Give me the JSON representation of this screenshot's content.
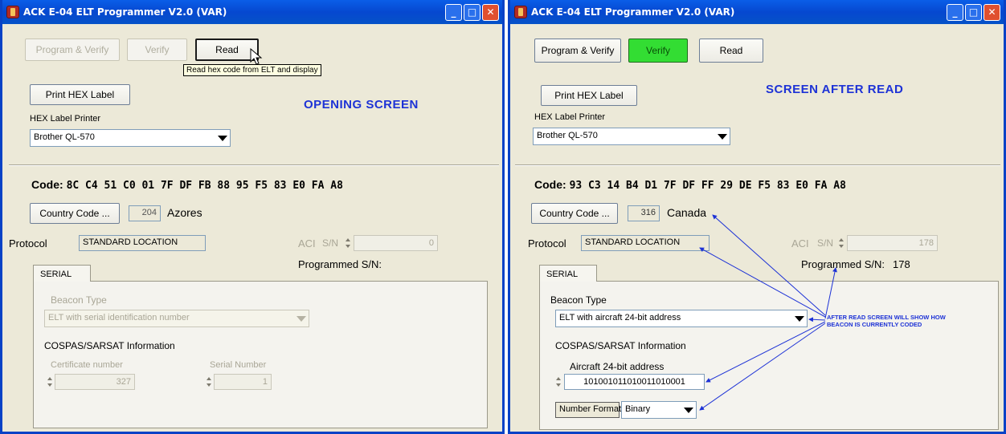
{
  "left": {
    "window_title": "ACK E-04 ELT Programmer V2.0 (VAR)",
    "btn_program_verify": "Program & Verify",
    "btn_verify": "Verify",
    "btn_read": "Read",
    "tooltip": "Read hex code from ELT and display",
    "btn_print_hex": "Print HEX Label",
    "caption": "OPENING SCREEN",
    "printer_label": "HEX Label Printer",
    "printer_value": "Brother QL-570",
    "code_label": "Code:",
    "code_hex": "8C C4 51 C0 01 7F DF FB 88 95 F5 83 E0 FA A8",
    "btn_country_code": "Country Code ...",
    "country_number": "204",
    "country_name": "Azores",
    "protocol_label": "Protocol",
    "protocol_value": "STANDARD LOCATION",
    "acl_label": "ACI",
    "sn_label": "S/N",
    "sn_value": "0",
    "programmed_sn_label": "Programmed S/N:",
    "programmed_sn_value": "",
    "tab_serial": "SERIAL",
    "beacon_type_label": "Beacon Type",
    "beacon_type_value": "ELT with serial identification number",
    "cospas_label": "COSPAS/SARSAT Information",
    "cert_label": "Certificate number",
    "cert_value": "327",
    "serial_label": "Serial Number",
    "serial_value": "1"
  },
  "right": {
    "window_title": "ACK E-04 ELT Programmer V2.0 (VAR)",
    "btn_program_verify": "Program & Verify",
    "btn_verify": "Verify",
    "btn_read": "Read",
    "btn_print_hex": "Print HEX Label",
    "caption": "SCREEN AFTER READ",
    "printer_label": "HEX Label Printer",
    "printer_value": "Brother QL-570",
    "code_label": "Code:",
    "code_hex": "93 C3 14 B4 D1 7F DF FF 29 DE F5 83 E0 FA A8",
    "btn_country_code": "Country Code ...",
    "country_number": "316",
    "country_name": "Canada",
    "protocol_label": "Protocol",
    "protocol_value": "STANDARD LOCATION",
    "acl_label": "ACI",
    "sn_label": "S/N",
    "sn_value": "178",
    "programmed_sn_label": "Programmed S/N:",
    "programmed_sn_value": "178",
    "tab_serial": "SERIAL",
    "beacon_type_label": "Beacon Type",
    "beacon_type_value": "ELT with aircraft 24-bit address",
    "cospas_label": "COSPAS/SARSAT Information",
    "aircraft_addr_label": "Aircraft 24-bit address",
    "aircraft_addr_value": "101001011010011010001",
    "number_format_label": "Number Format",
    "number_format_value": "Binary",
    "annotation_line1": "AFTER READ SCREEN WILL SHOW HOW",
    "annotation_line2": "BEACON IS CURRENTLY CODED"
  },
  "title_buttons": {
    "minimize": "_",
    "maximize": "□",
    "close": "✕"
  },
  "icons": [
    "app-icon",
    "minimize-icon",
    "maximize-icon",
    "close-icon",
    "dropdown-arrow-icon",
    "spin-icon",
    "mouse-cursor-icon"
  ],
  "colors": {
    "titlebar": "#0648d0",
    "window_bg": "#ece9d8",
    "verify_green": "#33dd33",
    "caption_blue": "#1d32d6"
  }
}
